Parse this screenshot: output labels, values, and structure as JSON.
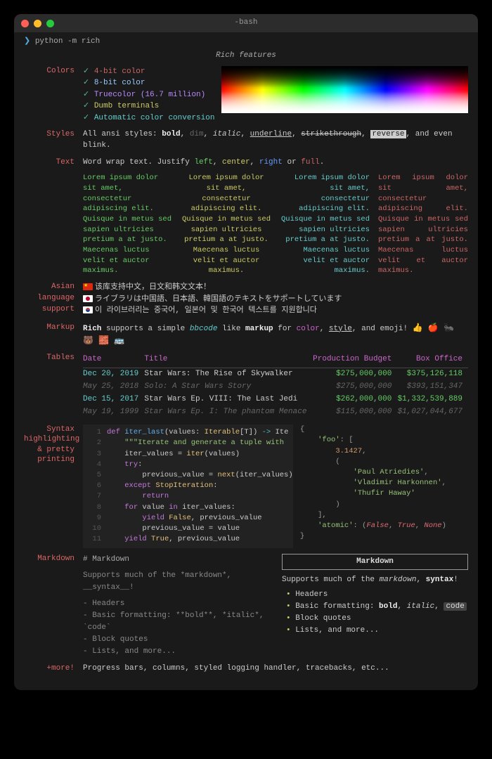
{
  "window": {
    "title": "-bash"
  },
  "prompt": {
    "caret": "❯",
    "command": "python -m rich"
  },
  "heading": "Rich features",
  "sections": {
    "colors": {
      "label": "Colors",
      "items": [
        {
          "check": "✓",
          "text": "4-bit color"
        },
        {
          "check": "✓",
          "text": "8-bit color"
        },
        {
          "check": "✓",
          "text": "Truecolor (16.7 million)"
        },
        {
          "check": "✓",
          "text": "Dumb terminals"
        },
        {
          "check": "✓",
          "text": "Automatic color conversion"
        }
      ]
    },
    "styles": {
      "label": "Styles",
      "lead": "All ansi styles: ",
      "parts": [
        "bold",
        "dim",
        "italic",
        "underline",
        "strikethrough",
        "reverse",
        ", and even blink."
      ]
    },
    "text": {
      "label": "Text",
      "lead": "Word wrap text. Justify ",
      "left": "left",
      "center": "center",
      "right": "right",
      "full": "full",
      "lorem": "Lorem ipsum dolor sit amet, consectetur adipiscing elit. Quisque in metus sed sapien ultricies pretium a at justo. Maecenas luctus velit et auctor maximus."
    },
    "asian": {
      "label": "Asian language support",
      "cn": "该库支持中文，日文和韩文文本！",
      "jp": "ライブラリは中国語、日本語、韓国語のテキストをサポートしています",
      "kr": "이 라이브러리는 중국어, 일본어 및 한국어 텍스트를 지원합니다"
    },
    "markup": {
      "label": "Markup",
      "pre": "Rich",
      "mid1": " supports a simple ",
      "bbcode": "bbcode",
      "mid2": " like ",
      "markup_word": "markup",
      "mid3": " for ",
      "color_word": "color",
      "comma": ", ",
      "style_word": "style",
      "tail": ", and emoji! ",
      "emoji": "👍 🍎 🐜 🐻 🧱 🚌"
    },
    "tables": {
      "label": "Tables",
      "headers": [
        "Date",
        "Title",
        "Production Budget",
        "Box Office"
      ],
      "rows": [
        {
          "dim": false,
          "date": "Dec 20, 2019",
          "title": "Star Wars: The Rise of Skywalker",
          "budget": "$275,000,000",
          "box": "$375,126,118"
        },
        {
          "dim": true,
          "date": "May 25, 2018",
          "title": "Solo: A Star Wars Story",
          "budget": "$275,000,000",
          "box": "$393,151,347"
        },
        {
          "dim": false,
          "date": "Dec 15, 2017",
          "title": "Star Wars Ep. VIII: The Last Jedi",
          "budget": "$262,000,000",
          "box": "$1,332,539,889"
        },
        {
          "dim": true,
          "date": "May 19, 1999",
          "title": "Star Wars Ep. I: The phantom Menace",
          "budget": "$115,000,000",
          "box": "$1,027,044,677"
        }
      ]
    },
    "syntax": {
      "label": "Syntax highlighting & pretty printing",
      "code_lines": [
        "def iter_last(values: Iterable[T]) -> Ite",
        "    \"\"\"Iterate and generate a tuple with",
        "    iter_values = iter(values)",
        "    try:",
        "        previous_value = next(iter_values)",
        "    except StopIteration:",
        "        return",
        "    for value in iter_values:",
        "        yield False, previous_value",
        "        previous_value = value",
        "    yield True, previous_value"
      ],
      "data_lines": [
        "{",
        "    'foo': [",
        "        3.1427,",
        "        (",
        "            'Paul Atriedies',",
        "            'Vladimir Harkonnen',",
        "            'Thufir Haway'",
        "        )",
        "    ],",
        "    'atomic': (False, True, None)",
        "}"
      ]
    },
    "markdown": {
      "label": "Markdown",
      "raw": {
        "h": "# Markdown",
        "line1": "Supports much of the *markdown*, __syntax__!",
        "items": [
          "- Headers",
          "- Basic formatting: **bold**, *italic*, `code`",
          "- Block quotes",
          "- Lists, and more..."
        ]
      },
      "render": {
        "box": "Markdown",
        "line1a": "Supports much of the ",
        "line1_md": "markdown",
        "line1b": ", ",
        "line1_syn": "syntax",
        "line1c": "!",
        "items": [
          "Headers",
          "Basic formatting: ",
          "Block quotes",
          "Lists, and more..."
        ],
        "bold": "bold",
        "italic": "italic",
        "code": "code"
      }
    },
    "more": {
      "label": "+more!",
      "text": "Progress bars, columns, styled logging handler, tracebacks, etc..."
    }
  }
}
